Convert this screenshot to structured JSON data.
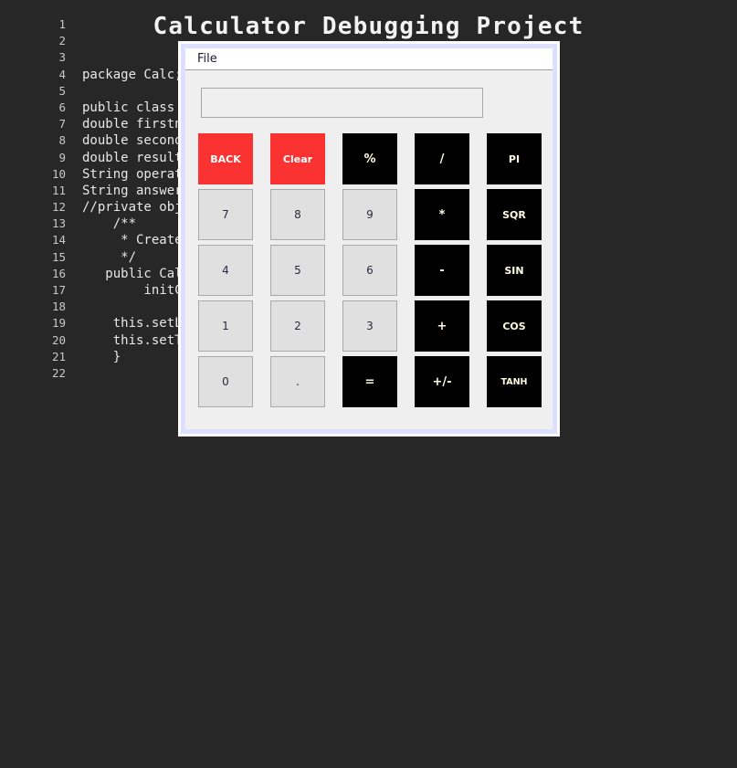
{
  "page": {
    "title": "Calculator Debugging Project",
    "background_color": "#272727",
    "text_color": "#e8e8e8"
  },
  "code": {
    "language": "java",
    "lines": [
      {
        "number": "1",
        "text": ""
      },
      {
        "number": "2",
        "text": ""
      },
      {
        "number": "3",
        "text": ""
      },
      {
        "number": "4",
        "text": "package Calc;"
      },
      {
        "number": "5",
        "text": ""
      },
      {
        "number": "6",
        "text": "public class Calc extends javax.swing.JFrame {"
      },
      {
        "number": "7",
        "text": "double firstnum;"
      },
      {
        "number": "8",
        "text": "double secondnum;"
      },
      {
        "number": "9",
        "text": "double result;"
      },
      {
        "number": "10",
        "text": "String operations;"
      },
      {
        "number": "11",
        "text": "String answer;"
      },
      {
        "number": "12",
        "text": "//private object math;"
      },
      {
        "number": "13",
        "text": "    /**"
      },
      {
        "number": "14",
        "text": "     * Creates new form Calc"
      },
      {
        "number": "15",
        "text": "     */"
      },
      {
        "number": "16",
        "text": "   public Calc() {"
      },
      {
        "number": "17",
        "text": "        initComponents();"
      },
      {
        "number": "18",
        "text": ""
      },
      {
        "number": "19",
        "text": "    this.setLocationRelativeTo(null);"
      },
      {
        "number": "20",
        "text": "    this.setTitle(\"Scientific Calculator\");"
      },
      {
        "number": "21",
        "text": "    }"
      },
      {
        "number": "22",
        "text": ""
      }
    ]
  },
  "calculator": {
    "menu": {
      "file_label": "File"
    },
    "display": {
      "value": "",
      "placeholder": ""
    },
    "colors": {
      "red_button": "#fb3232",
      "black_button": "#000000",
      "number_button": "#e0e0e0",
      "window_chrome": "#dedeff",
      "panel": "#efefef"
    },
    "keypad": {
      "rows": [
        [
          {
            "label": "BACK",
            "style": "red"
          },
          {
            "label": "Clear",
            "style": "red"
          },
          {
            "label": "%",
            "style": "black-sym"
          },
          {
            "label": "/",
            "style": "black-sym"
          },
          {
            "label": "PI",
            "style": "black"
          }
        ],
        [
          {
            "label": "7",
            "style": "num"
          },
          {
            "label": "8",
            "style": "num"
          },
          {
            "label": "9",
            "style": "num"
          },
          {
            "label": "*",
            "style": "black-sym"
          },
          {
            "label": "SQR",
            "style": "black"
          }
        ],
        [
          {
            "label": "4",
            "style": "num"
          },
          {
            "label": "5",
            "style": "num"
          },
          {
            "label": "6",
            "style": "num"
          },
          {
            "label": "-",
            "style": "black-sym"
          },
          {
            "label": "SIN",
            "style": "black"
          }
        ],
        [
          {
            "label": "1",
            "style": "num"
          },
          {
            "label": "2",
            "style": "num"
          },
          {
            "label": "3",
            "style": "num"
          },
          {
            "label": "+",
            "style": "black-sym"
          },
          {
            "label": "COS",
            "style": "black"
          }
        ],
        [
          {
            "label": "0",
            "style": "num"
          },
          {
            "label": ".",
            "style": "num"
          },
          {
            "label": "=",
            "style": "black-sym"
          },
          {
            "label": "+/-",
            "style": "black-sym"
          },
          {
            "label": "TANH",
            "style": "black-small"
          }
        ]
      ]
    }
  }
}
